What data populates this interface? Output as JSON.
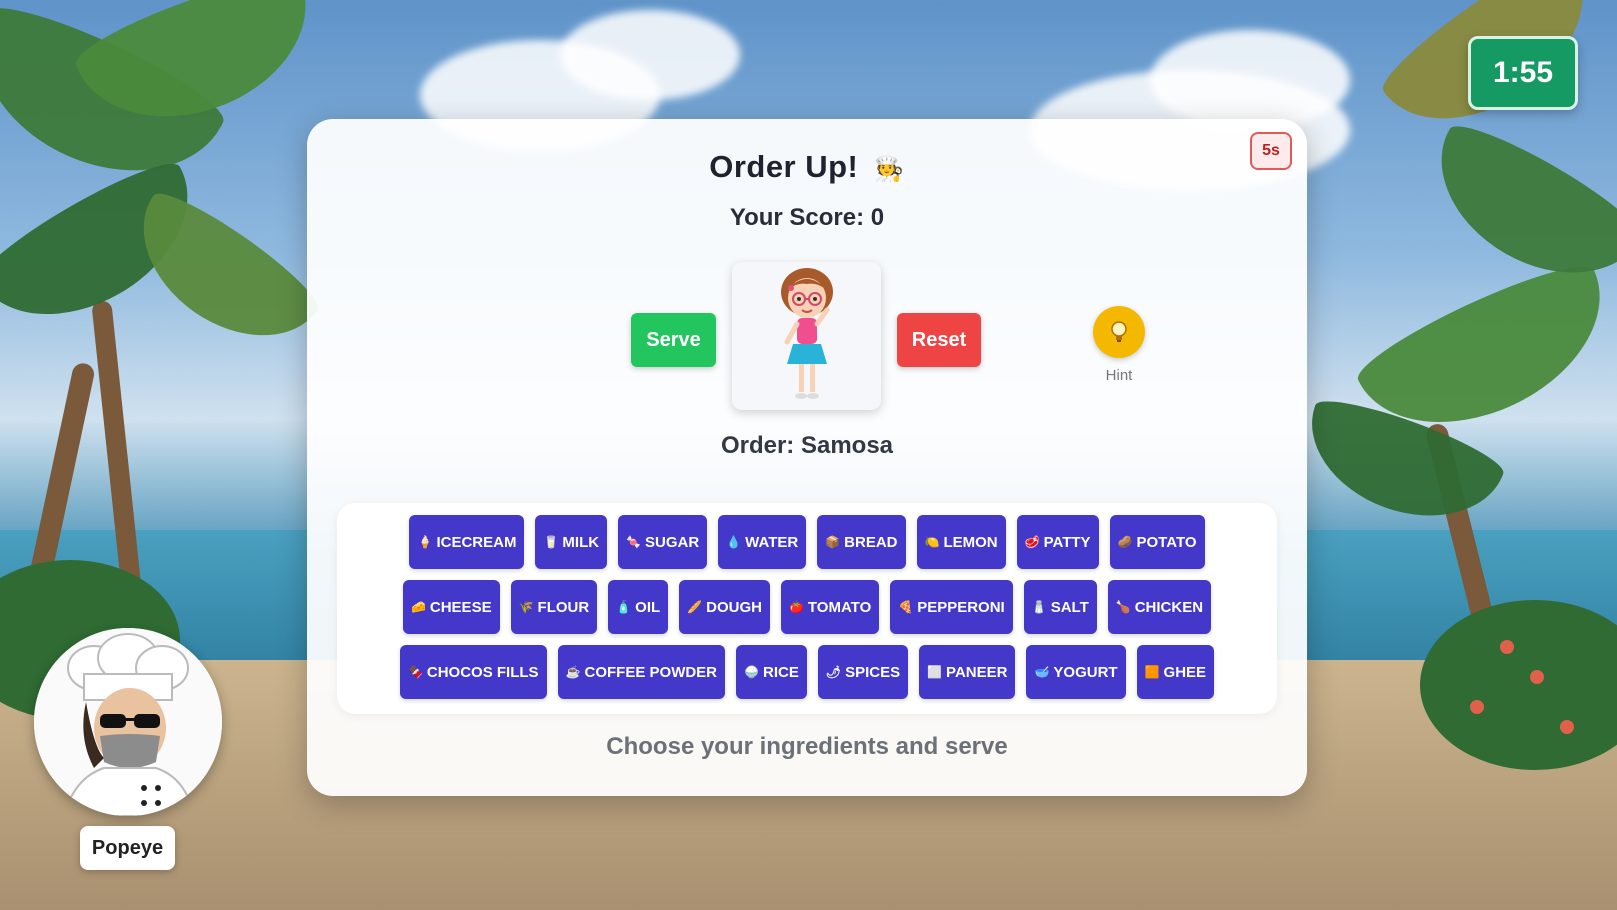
{
  "timer": "1:55",
  "card": {
    "countdown": "5s",
    "title": "Order Up!",
    "title_icon": "chef-emoji",
    "score_label": "Your Score: 0",
    "serve_label": "Serve",
    "reset_label": "Reset",
    "hint_label": "Hint",
    "order_label": "Order: Samosa",
    "instruction": "Choose your ingredients and serve"
  },
  "ingredients": {
    "row1": [
      {
        "label": "ICECREAM",
        "icon": "🍦"
      },
      {
        "label": "MILK",
        "icon": "🥛"
      },
      {
        "label": "SUGAR",
        "icon": "🍬"
      },
      {
        "label": "WATER",
        "icon": "💧"
      },
      {
        "label": "BREAD",
        "icon": "📦"
      },
      {
        "label": "LEMON",
        "icon": "🍋"
      },
      {
        "label": "PATTY",
        "icon": "🥩"
      },
      {
        "label": "POTATO",
        "icon": "🥔"
      }
    ],
    "row2": [
      {
        "label": "CHEESE",
        "icon": "🧀"
      },
      {
        "label": "FLOUR",
        "icon": "🌾"
      },
      {
        "label": "OIL",
        "icon": "🧴"
      },
      {
        "label": "DOUGH",
        "icon": "🥖"
      },
      {
        "label": "TOMATO",
        "icon": "🍅"
      },
      {
        "label": "PEPPERONI",
        "icon": "🍕"
      },
      {
        "label": "SALT",
        "icon": "🧂"
      },
      {
        "label": "CHICKEN",
        "icon": "🍗"
      }
    ],
    "row3": [
      {
        "label": "CHOCOS FILLS",
        "icon": "🍫"
      },
      {
        "label": "COFFEE POWDER",
        "icon": "☕"
      },
      {
        "label": "RICE",
        "icon": "🍚"
      },
      {
        "label": "SPICES",
        "icon": "🌶"
      },
      {
        "label": "PANEER",
        "icon": "⬜"
      },
      {
        "label": "YOGURT",
        "icon": "🥣"
      },
      {
        "label": "GHEE",
        "icon": "🟧"
      }
    ]
  },
  "player": {
    "name": "Popeye"
  },
  "colors": {
    "ingredient_bg": "#4338ca",
    "serve": "#22c55e",
    "reset": "#ef4444",
    "hint": "#f5b800",
    "timer": "#169a64"
  }
}
